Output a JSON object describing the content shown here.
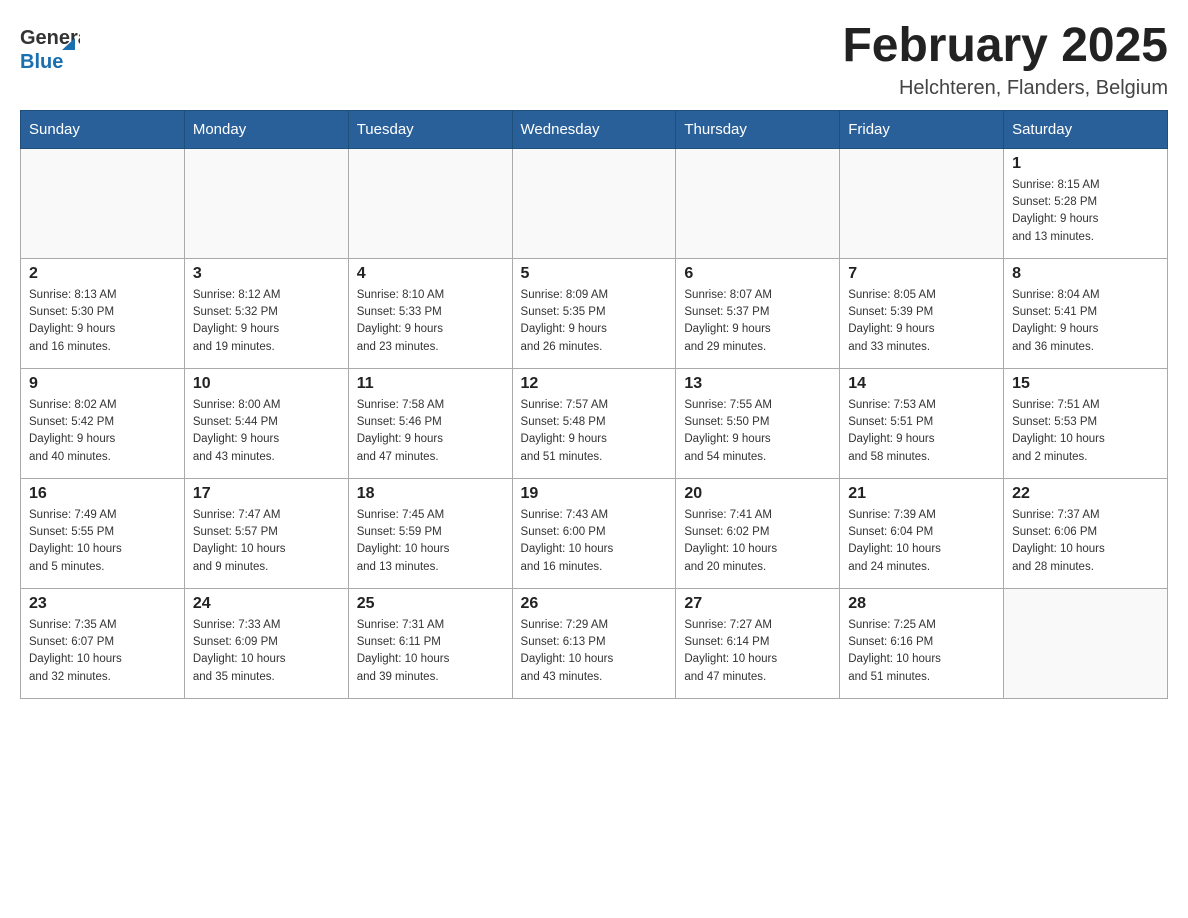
{
  "header": {
    "logo_general": "General",
    "logo_blue": "Blue",
    "title": "February 2025",
    "subtitle": "Helchteren, Flanders, Belgium"
  },
  "days_of_week": [
    "Sunday",
    "Monday",
    "Tuesday",
    "Wednesday",
    "Thursday",
    "Friday",
    "Saturday"
  ],
  "weeks": [
    [
      {
        "day": "",
        "info": ""
      },
      {
        "day": "",
        "info": ""
      },
      {
        "day": "",
        "info": ""
      },
      {
        "day": "",
        "info": ""
      },
      {
        "day": "",
        "info": ""
      },
      {
        "day": "",
        "info": ""
      },
      {
        "day": "1",
        "info": "Sunrise: 8:15 AM\nSunset: 5:28 PM\nDaylight: 9 hours\nand 13 minutes."
      }
    ],
    [
      {
        "day": "2",
        "info": "Sunrise: 8:13 AM\nSunset: 5:30 PM\nDaylight: 9 hours\nand 16 minutes."
      },
      {
        "day": "3",
        "info": "Sunrise: 8:12 AM\nSunset: 5:32 PM\nDaylight: 9 hours\nand 19 minutes."
      },
      {
        "day": "4",
        "info": "Sunrise: 8:10 AM\nSunset: 5:33 PM\nDaylight: 9 hours\nand 23 minutes."
      },
      {
        "day": "5",
        "info": "Sunrise: 8:09 AM\nSunset: 5:35 PM\nDaylight: 9 hours\nand 26 minutes."
      },
      {
        "day": "6",
        "info": "Sunrise: 8:07 AM\nSunset: 5:37 PM\nDaylight: 9 hours\nand 29 minutes."
      },
      {
        "day": "7",
        "info": "Sunrise: 8:05 AM\nSunset: 5:39 PM\nDaylight: 9 hours\nand 33 minutes."
      },
      {
        "day": "8",
        "info": "Sunrise: 8:04 AM\nSunset: 5:41 PM\nDaylight: 9 hours\nand 36 minutes."
      }
    ],
    [
      {
        "day": "9",
        "info": "Sunrise: 8:02 AM\nSunset: 5:42 PM\nDaylight: 9 hours\nand 40 minutes."
      },
      {
        "day": "10",
        "info": "Sunrise: 8:00 AM\nSunset: 5:44 PM\nDaylight: 9 hours\nand 43 minutes."
      },
      {
        "day": "11",
        "info": "Sunrise: 7:58 AM\nSunset: 5:46 PM\nDaylight: 9 hours\nand 47 minutes."
      },
      {
        "day": "12",
        "info": "Sunrise: 7:57 AM\nSunset: 5:48 PM\nDaylight: 9 hours\nand 51 minutes."
      },
      {
        "day": "13",
        "info": "Sunrise: 7:55 AM\nSunset: 5:50 PM\nDaylight: 9 hours\nand 54 minutes."
      },
      {
        "day": "14",
        "info": "Sunrise: 7:53 AM\nSunset: 5:51 PM\nDaylight: 9 hours\nand 58 minutes."
      },
      {
        "day": "15",
        "info": "Sunrise: 7:51 AM\nSunset: 5:53 PM\nDaylight: 10 hours\nand 2 minutes."
      }
    ],
    [
      {
        "day": "16",
        "info": "Sunrise: 7:49 AM\nSunset: 5:55 PM\nDaylight: 10 hours\nand 5 minutes."
      },
      {
        "day": "17",
        "info": "Sunrise: 7:47 AM\nSunset: 5:57 PM\nDaylight: 10 hours\nand 9 minutes."
      },
      {
        "day": "18",
        "info": "Sunrise: 7:45 AM\nSunset: 5:59 PM\nDaylight: 10 hours\nand 13 minutes."
      },
      {
        "day": "19",
        "info": "Sunrise: 7:43 AM\nSunset: 6:00 PM\nDaylight: 10 hours\nand 16 minutes."
      },
      {
        "day": "20",
        "info": "Sunrise: 7:41 AM\nSunset: 6:02 PM\nDaylight: 10 hours\nand 20 minutes."
      },
      {
        "day": "21",
        "info": "Sunrise: 7:39 AM\nSunset: 6:04 PM\nDaylight: 10 hours\nand 24 minutes."
      },
      {
        "day": "22",
        "info": "Sunrise: 7:37 AM\nSunset: 6:06 PM\nDaylight: 10 hours\nand 28 minutes."
      }
    ],
    [
      {
        "day": "23",
        "info": "Sunrise: 7:35 AM\nSunset: 6:07 PM\nDaylight: 10 hours\nand 32 minutes."
      },
      {
        "day": "24",
        "info": "Sunrise: 7:33 AM\nSunset: 6:09 PM\nDaylight: 10 hours\nand 35 minutes."
      },
      {
        "day": "25",
        "info": "Sunrise: 7:31 AM\nSunset: 6:11 PM\nDaylight: 10 hours\nand 39 minutes."
      },
      {
        "day": "26",
        "info": "Sunrise: 7:29 AM\nSunset: 6:13 PM\nDaylight: 10 hours\nand 43 minutes."
      },
      {
        "day": "27",
        "info": "Sunrise: 7:27 AM\nSunset: 6:14 PM\nDaylight: 10 hours\nand 47 minutes."
      },
      {
        "day": "28",
        "info": "Sunrise: 7:25 AM\nSunset: 6:16 PM\nDaylight: 10 hours\nand 51 minutes."
      },
      {
        "day": "",
        "info": ""
      }
    ]
  ]
}
